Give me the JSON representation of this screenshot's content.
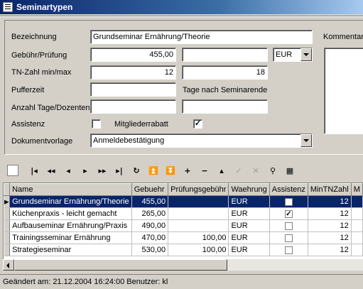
{
  "window": {
    "title": "Seminartypen"
  },
  "form": {
    "bezeichnung_label": "Bezeichnung",
    "bezeichnung_value": "Grundseminar Ernährung/Theorie",
    "kommentar_label": "Kommentar",
    "gebuehr_label": "Gebühr/Prüfung",
    "gebuehr_value": "455,00",
    "pruefung_value": "",
    "currency_value": "EUR",
    "tn_label": "TN-Zahl min/max",
    "tn_min": "12",
    "tn_max": "18",
    "puffer_label": "Pufferzeit",
    "puffer_value": "",
    "puffer_suffix": "Tage nach Seminarende",
    "tage_label": "Anzahl Tage/Dozenten",
    "tage_value": "",
    "dozenten_value": "",
    "assistenz_label": "Assistenz",
    "assistenz_checked": false,
    "mitglieder_label": "Mitgliederrabatt",
    "mitglieder_checked": true,
    "vorlage_label": "Dokumentvorlage",
    "vorlage_value": "Anmeldebestätigung"
  },
  "toolbar": {
    "buttons": [
      {
        "name": "first-record-button",
        "glyph": "|◂",
        "disabled": false
      },
      {
        "name": "prev-page-button",
        "glyph": "◂◂",
        "disabled": false
      },
      {
        "name": "prev-record-button",
        "glyph": "◂",
        "disabled": false
      },
      {
        "name": "next-record-button",
        "glyph": "▸",
        "disabled": false
      },
      {
        "name": "next-page-button",
        "glyph": "▸▸",
        "disabled": false
      },
      {
        "name": "last-record-button",
        "glyph": "▸|",
        "disabled": false
      },
      {
        "name": "refresh-button",
        "glyph": "↻",
        "disabled": false
      },
      {
        "name": "move-top-button",
        "glyph": "⏫",
        "disabled": false
      },
      {
        "name": "move-bottom-button",
        "glyph": "⏬",
        "disabled": false
      },
      {
        "name": "insert-button",
        "glyph": "+",
        "disabled": false
      },
      {
        "name": "delete-button",
        "glyph": "−",
        "disabled": false
      },
      {
        "name": "edit-button",
        "glyph": "▴",
        "disabled": false
      },
      {
        "name": "post-button",
        "glyph": "✓",
        "disabled": true
      },
      {
        "name": "cancel-button",
        "glyph": "✕",
        "disabled": true
      },
      {
        "name": "filter-button",
        "glyph": "⚲",
        "disabled": false
      },
      {
        "name": "print-button",
        "glyph": "▦",
        "disabled": false
      }
    ]
  },
  "grid": {
    "columns": [
      "Name",
      "Gebuehr",
      "Prüfungsgebühr",
      "Waehrung",
      "Assistenz",
      "MinTNZahl",
      "M"
    ],
    "rows": [
      {
        "name": "Grundseminar Ernährung/Theorie",
        "gebuehr": "455,00",
        "pruefung": "",
        "waehrung": "EUR",
        "assistenz": false,
        "min": "12",
        "selected": true
      },
      {
        "name": "Küchenpraxis - leicht gemacht",
        "gebuehr": "265,00",
        "pruefung": "",
        "waehrung": "EUR",
        "assistenz": true,
        "min": "12",
        "selected": false
      },
      {
        "name": "Aufbauseminar Ernährung/Praxis",
        "gebuehr": "490,00",
        "pruefung": "",
        "waehrung": "EUR",
        "assistenz": false,
        "min": "12",
        "selected": false
      },
      {
        "name": "Trainingsseminar Ernährung",
        "gebuehr": "470,00",
        "pruefung": "100,00",
        "waehrung": "EUR",
        "assistenz": false,
        "min": "12",
        "selected": false
      },
      {
        "name": "Strategieseminar",
        "gebuehr": "530,00",
        "pruefung": "100,00",
        "waehrung": "EUR",
        "assistenz": false,
        "min": "12",
        "selected": false
      }
    ]
  },
  "status": {
    "text": "Geändert am: 21.12.2004 16:24:00 Benutzer: kl"
  }
}
